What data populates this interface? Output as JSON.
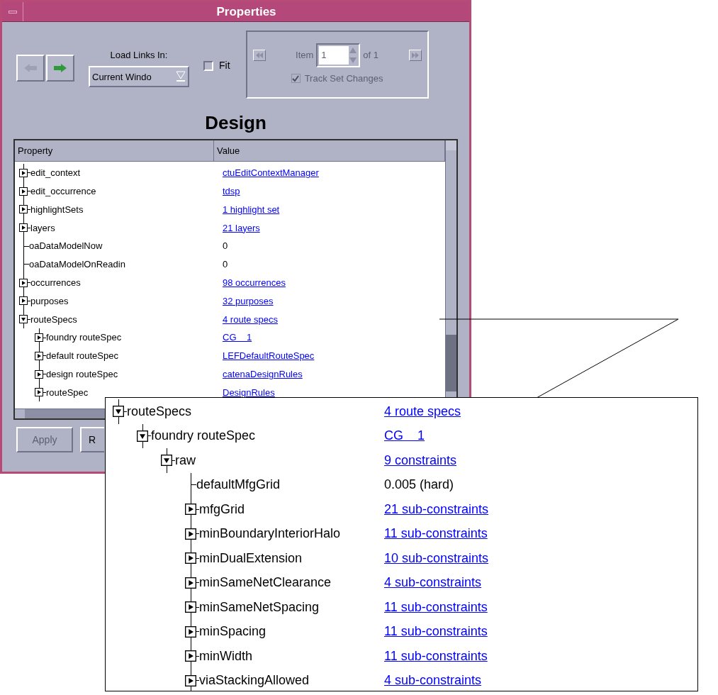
{
  "window": {
    "title": "Properties"
  },
  "toolbar": {
    "back_button": {
      "disabled": true
    },
    "forward_button": {
      "disabled": false
    },
    "load_links_label": "Load Links In:",
    "load_links_value": "Current Windo",
    "fit": {
      "label": "Fit",
      "checked": false
    }
  },
  "item_navigator": {
    "disabled": true,
    "item_label": "Item",
    "item_value": "1",
    "of_label": "of 1",
    "track": {
      "label": "Track Set Changes",
      "checked": true
    }
  },
  "heading": "Design",
  "table": {
    "columns": [
      "Property",
      "Value"
    ],
    "rows": [
      {
        "label": "edit_context",
        "expanded": false,
        "value": "ctuEditContextManager",
        "kind": "link"
      },
      {
        "label": "edit_occurrence",
        "expanded": false,
        "value": "tdsp",
        "kind": "link"
      },
      {
        "label": "highlightSets",
        "expanded": false,
        "value": "1 highlight set",
        "kind": "link"
      },
      {
        "label": "layers",
        "expanded": false,
        "value": "21 layers",
        "kind": "link"
      },
      {
        "label": "oaDataModelNow",
        "value": "0",
        "kind": "text"
      },
      {
        "label": "oaDataModelOnReadin",
        "value": "0",
        "kind": "text"
      },
      {
        "label": "occurrences",
        "expanded": false,
        "value": "98 occurrences",
        "kind": "link"
      },
      {
        "label": "purposes",
        "expanded": false,
        "value": "32 purposes",
        "kind": "link"
      },
      {
        "label": "routeSpecs",
        "expanded": true,
        "value": "4 route specs",
        "kind": "link",
        "children": [
          {
            "label": "foundry routeSpec",
            "expanded": false,
            "value": "CG    1",
            "kind": "link"
          },
          {
            "label": "default routeSpec",
            "expanded": false,
            "value": "LEFDefaultRouteSpec",
            "kind": "link"
          },
          {
            "label": "design routeSpec",
            "expanded": false,
            "value": "catenaDesignRules",
            "kind": "link"
          },
          {
            "label": "routeSpec",
            "expanded": false,
            "value": "DesignRules",
            "kind": "link"
          }
        ]
      }
    ]
  },
  "buttons": [
    {
      "label": "Apply",
      "disabled": true
    },
    {
      "label": "R",
      "disabled": false
    }
  ],
  "callout": {
    "rows": [
      {
        "label": "routeSpecs",
        "expanded": true,
        "value": "4 route specs",
        "kind": "link",
        "children": [
          {
            "label": "foundry routeSpec",
            "expanded": true,
            "value": "CG    1",
            "kind": "link",
            "children": [
              {
                "label": "raw",
                "expanded": true,
                "value": "9 constraints",
                "kind": "link",
                "children": [
                  {
                    "label": "defaultMfgGrid",
                    "value": "0.005 (hard)",
                    "kind": "text"
                  },
                  {
                    "label": "mfgGrid",
                    "expanded": false,
                    "value": "21 sub-constraints",
                    "kind": "link"
                  },
                  {
                    "label": "minBoundaryInteriorHalo",
                    "expanded": false,
                    "value": "11 sub-constraints",
                    "kind": "link"
                  },
                  {
                    "label": "minDualExtension",
                    "expanded": false,
                    "value": "10 sub-constraints",
                    "kind": "link"
                  },
                  {
                    "label": "minSameNetClearance",
                    "expanded": false,
                    "value": "4 sub-constraints",
                    "kind": "link"
                  },
                  {
                    "label": "minSameNetSpacing",
                    "expanded": false,
                    "value": "11 sub-constraints",
                    "kind": "link"
                  },
                  {
                    "label": "minSpacing",
                    "expanded": false,
                    "value": "11 sub-constraints",
                    "kind": "link"
                  },
                  {
                    "label": "minWidth",
                    "expanded": false,
                    "value": "11 sub-constraints",
                    "kind": "link"
                  },
                  {
                    "label": "viaStackingAllowed",
                    "expanded": false,
                    "value": "4 sub-constraints",
                    "kind": "link"
                  }
                ]
              }
            ]
          }
        ]
      }
    ]
  }
}
